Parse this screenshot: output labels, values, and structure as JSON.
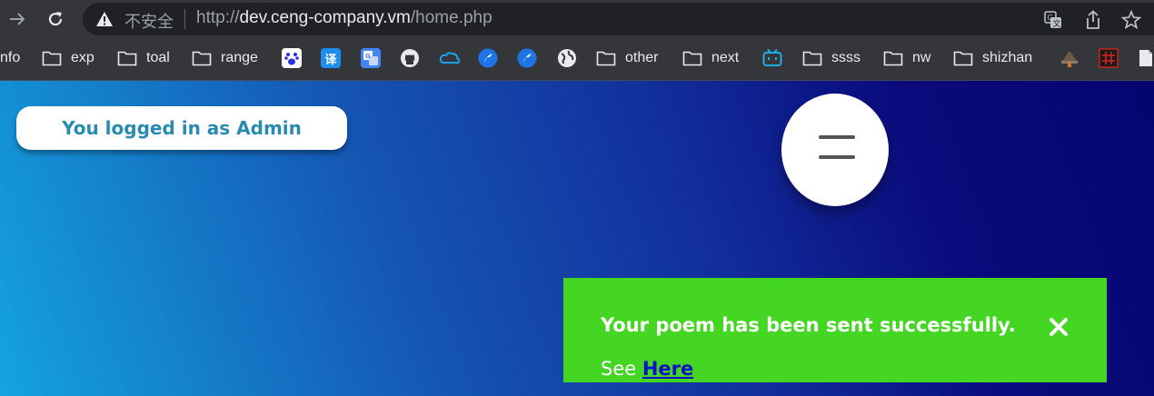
{
  "browser": {
    "insecure_label": "不安全",
    "url_scheme": "http://",
    "url_host": "dev.ceng-company.vm",
    "url_path": "/home.php",
    "icons": [
      "back-arrow-icon",
      "reload-icon",
      "warning-icon",
      "translate-icon",
      "share-icon",
      "star-icon"
    ]
  },
  "bookmarks": {
    "items": [
      {
        "label": "nfo"
      },
      {
        "label": "exp"
      },
      {
        "label": "toal"
      },
      {
        "label": "range"
      },
      {
        "label": "other"
      },
      {
        "label": "next"
      },
      {
        "label": "ssss"
      },
      {
        "label": "nw"
      },
      {
        "label": "shizhan"
      }
    ],
    "fav_translate": "译"
  },
  "page": {
    "login_status": "You logged in as Admin",
    "toast": {
      "message": "Your poem has been sent successfully.",
      "see_prefix": "See ",
      "link_label": "Here",
      "color": "#44d622",
      "link_color": "#0b10c9"
    }
  }
}
